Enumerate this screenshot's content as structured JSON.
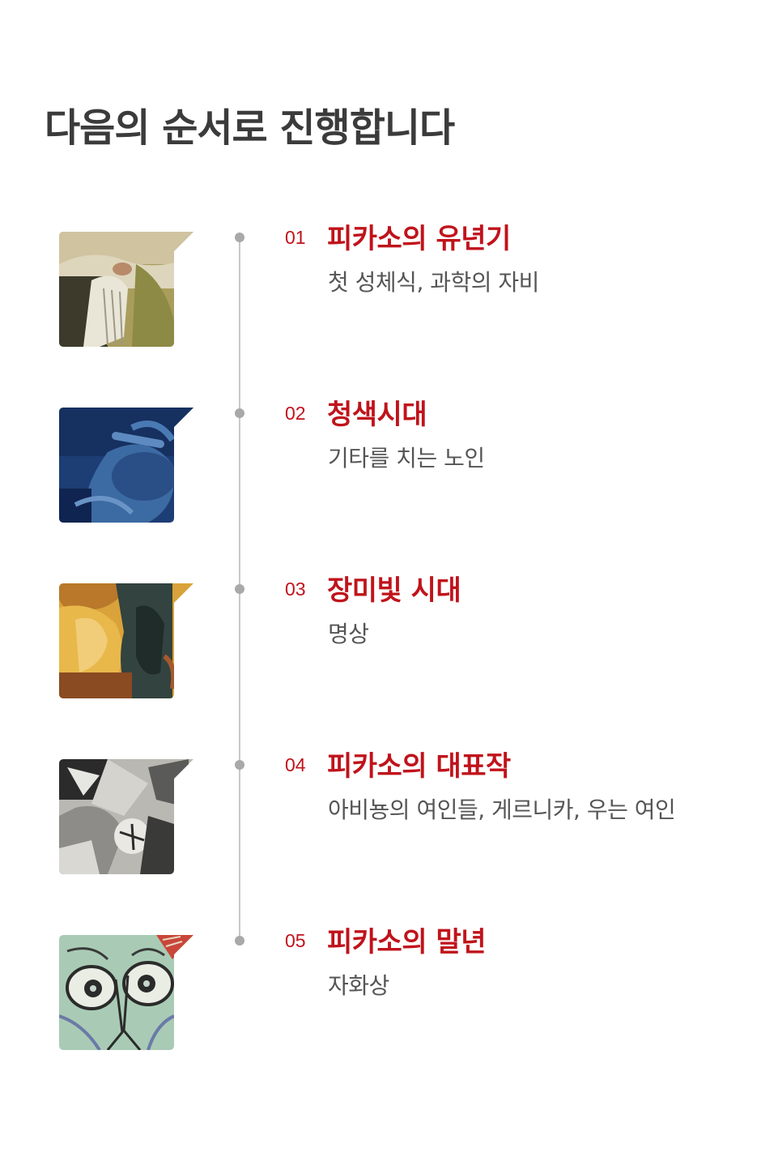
{
  "header": {
    "title": "다음의 순서로 진행합니다"
  },
  "steps": [
    {
      "number": "01",
      "title": "피카소의 유년기",
      "subtitle": "첫 성체식, 과학의 자비",
      "thumbnail_icon": "painting-first-communion-icon",
      "palette": [
        "#c9b98a",
        "#6d6a3c",
        "#3a3a2a"
      ]
    },
    {
      "number": "02",
      "title": "청색시대",
      "subtitle": "기타를 치는 노인",
      "thumbnail_icon": "painting-old-guitarist-icon",
      "palette": [
        "#1e3f78",
        "#4a78ad",
        "#0e2247"
      ]
    },
    {
      "number": "03",
      "title": "장미빛 시대",
      "subtitle": "명상",
      "thumbnail_icon": "painting-meditation-icon",
      "palette": [
        "#e0a53a",
        "#344a48",
        "#7a3a1e"
      ]
    },
    {
      "number": "04",
      "title": "피카소의 대표작",
      "subtitle": "아비뇽의 여인들, 게르니카, 우는 여인",
      "thumbnail_icon": "painting-guernica-icon",
      "palette": [
        "#c9c9c4",
        "#2a2a2a",
        "#8a8a86"
      ]
    },
    {
      "number": "05",
      "title": "피카소의 말년",
      "subtitle": "자화상",
      "thumbnail_icon": "painting-self-portrait-icon",
      "palette": [
        "#9cc4ad",
        "#2a2a2a",
        "#c4473a"
      ]
    }
  ]
}
